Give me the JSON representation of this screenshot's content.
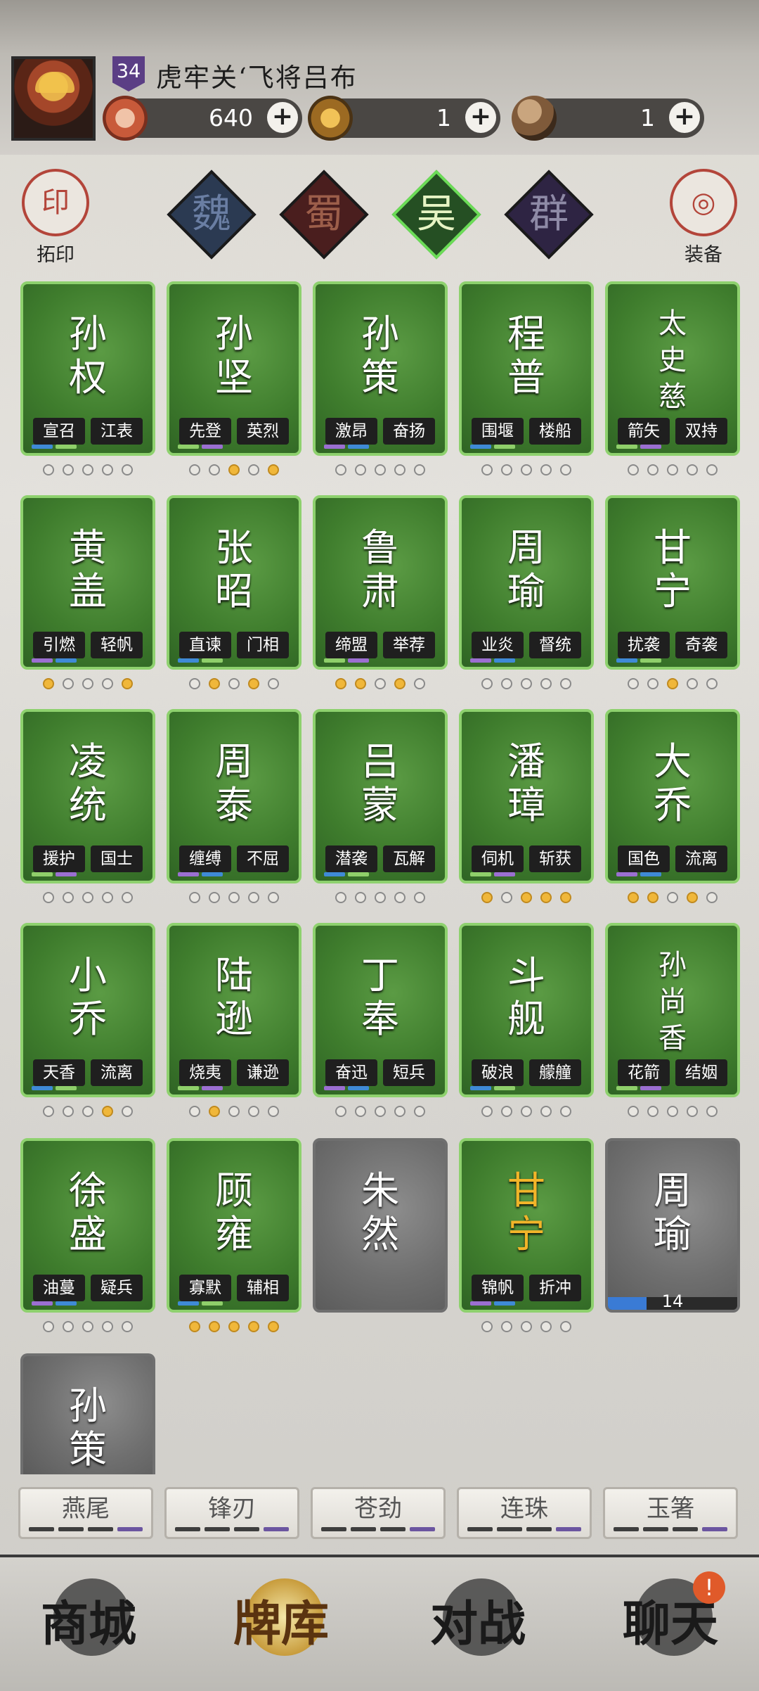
{
  "header": {
    "level": "34",
    "stage_title": "虎牢关‘飞将吕布",
    "resources": [
      {
        "icon": "crossed-swords-icon",
        "value": "640"
      },
      {
        "icon": "scroll-icon",
        "value": "1"
      },
      {
        "icon": "orb-icon",
        "value": "1"
      }
    ]
  },
  "side_buttons": {
    "left": {
      "icon": "seal-icon",
      "glyph": "印",
      "label": "拓印"
    },
    "right": {
      "icon": "equipment-icon",
      "glyph": "◎",
      "label": "装备"
    }
  },
  "factions": [
    {
      "label": "魏",
      "color": "#4a5c7c",
      "active": false
    },
    {
      "label": "蜀",
      "color": "#6d2f2f",
      "active": false
    },
    {
      "label": "吴",
      "color": "#3fa33a",
      "active": true
    },
    {
      "label": "群",
      "color": "#4b3a6b",
      "active": false
    }
  ],
  "cards": [
    {
      "name": "孙权",
      "skills": [
        "宣召",
        "江表"
      ],
      "stars": [
        0,
        0,
        0,
        0,
        0
      ],
      "state": "green"
    },
    {
      "name": "孙坚",
      "skills": [
        "先登",
        "英烈"
      ],
      "stars": [
        0,
        0,
        1,
        0,
        1
      ],
      "state": "green"
    },
    {
      "name": "孙策",
      "skills": [
        "激昂",
        "奋扬"
      ],
      "stars": [
        0,
        0,
        0,
        0,
        0
      ],
      "state": "green"
    },
    {
      "name": "程普",
      "skills": [
        "围堰",
        "楼船"
      ],
      "stars": [
        0,
        0,
        0,
        0,
        0
      ],
      "state": "green"
    },
    {
      "name": "太史慈",
      "skills": [
        "箭矢",
        "双持"
      ],
      "stars": [
        0,
        0,
        0,
        0,
        0
      ],
      "state": "green"
    },
    {
      "name": "黄盖",
      "skills": [
        "引燃",
        "轻帆"
      ],
      "stars": [
        1,
        0,
        0,
        0,
        1
      ],
      "state": "green"
    },
    {
      "name": "张昭",
      "skills": [
        "直谏",
        "门相"
      ],
      "stars": [
        0,
        1,
        0,
        1,
        0
      ],
      "state": "green"
    },
    {
      "name": "鲁肃",
      "skills": [
        "缔盟",
        "举荐"
      ],
      "stars": [
        1,
        1,
        0,
        1,
        0
      ],
      "state": "green"
    },
    {
      "name": "周瑜",
      "skills": [
        "业炎",
        "督统"
      ],
      "stars": [
        0,
        0,
        0,
        0,
        0
      ],
      "state": "green"
    },
    {
      "name": "甘宁",
      "skills": [
        "扰袭",
        "奇袭"
      ],
      "stars": [
        0,
        0,
        1,
        0,
        0
      ],
      "state": "green"
    },
    {
      "name": "凌统",
      "skills": [
        "援护",
        "国士"
      ],
      "stars": [
        0,
        0,
        0,
        0,
        0
      ],
      "state": "green"
    },
    {
      "name": "周泰",
      "skills": [
        "缠缚",
        "不屈"
      ],
      "stars": [
        0,
        0,
        0,
        0,
        0
      ],
      "state": "green"
    },
    {
      "name": "吕蒙",
      "skills": [
        "潜袭",
        "瓦解"
      ],
      "stars": [
        0,
        0,
        0,
        0,
        0
      ],
      "state": "green"
    },
    {
      "name": "潘璋",
      "skills": [
        "伺机",
        "斩获"
      ],
      "stars": [
        1,
        0,
        1,
        1,
        1
      ],
      "state": "green"
    },
    {
      "name": "大乔",
      "skills": [
        "国色",
        "流离"
      ],
      "stars": [
        1,
        1,
        0,
        1,
        0
      ],
      "state": "green"
    },
    {
      "name": "小乔",
      "skills": [
        "天香",
        "流离"
      ],
      "stars": [
        0,
        0,
        0,
        1,
        0
      ],
      "state": "green"
    },
    {
      "name": "陆逊",
      "skills": [
        "烧夷",
        "谦逊"
      ],
      "stars": [
        0,
        1,
        0,
        0,
        0
      ],
      "state": "green"
    },
    {
      "name": "丁奉",
      "skills": [
        "奋迅",
        "短兵"
      ],
      "stars": [
        0,
        0,
        0,
        0,
        0
      ],
      "state": "green"
    },
    {
      "name": "斗舰",
      "skills": [
        "破浪",
        "艨艟"
      ],
      "stars": [
        0,
        0,
        0,
        0,
        0
      ],
      "state": "green"
    },
    {
      "name": "孙尚香",
      "skills": [
        "花箭",
        "结姻"
      ],
      "stars": [
        0,
        0,
        0,
        0,
        0
      ],
      "state": "green-gray"
    },
    {
      "name": "徐盛",
      "skills": [
        "油蔓",
        "疑兵"
      ],
      "stars": [
        0,
        0,
        0,
        0,
        0
      ],
      "state": "green"
    },
    {
      "name": "顾雍",
      "skills": [
        "寡默",
        "辅相"
      ],
      "stars": [
        1,
        1,
        1,
        1,
        1
      ],
      "state": "green"
    },
    {
      "name": "朱然",
      "skills": [],
      "stars": null,
      "state": "gray"
    },
    {
      "name": "甘宁",
      "skills": [
        "锦帆",
        "折冲"
      ],
      "stars": [
        0,
        0,
        0,
        0,
        0
      ],
      "state": "green-gold"
    },
    {
      "name": "周瑜",
      "skills": [],
      "stars": null,
      "state": "gray",
      "progress": "14",
      "progress_fill": 0.3
    },
    {
      "name": "孙策",
      "skills": [],
      "stars": null,
      "state": "gray-partial"
    }
  ],
  "category_tabs": [
    "燕尾",
    "锋刃",
    "苍劲",
    "连珠",
    "玉箸"
  ],
  "bottom_nav": [
    {
      "label": "商城",
      "active": false
    },
    {
      "label": "牌库",
      "active": true
    },
    {
      "label": "对战",
      "active": false
    },
    {
      "label": "聊天",
      "active": false,
      "badge": "!"
    }
  ]
}
